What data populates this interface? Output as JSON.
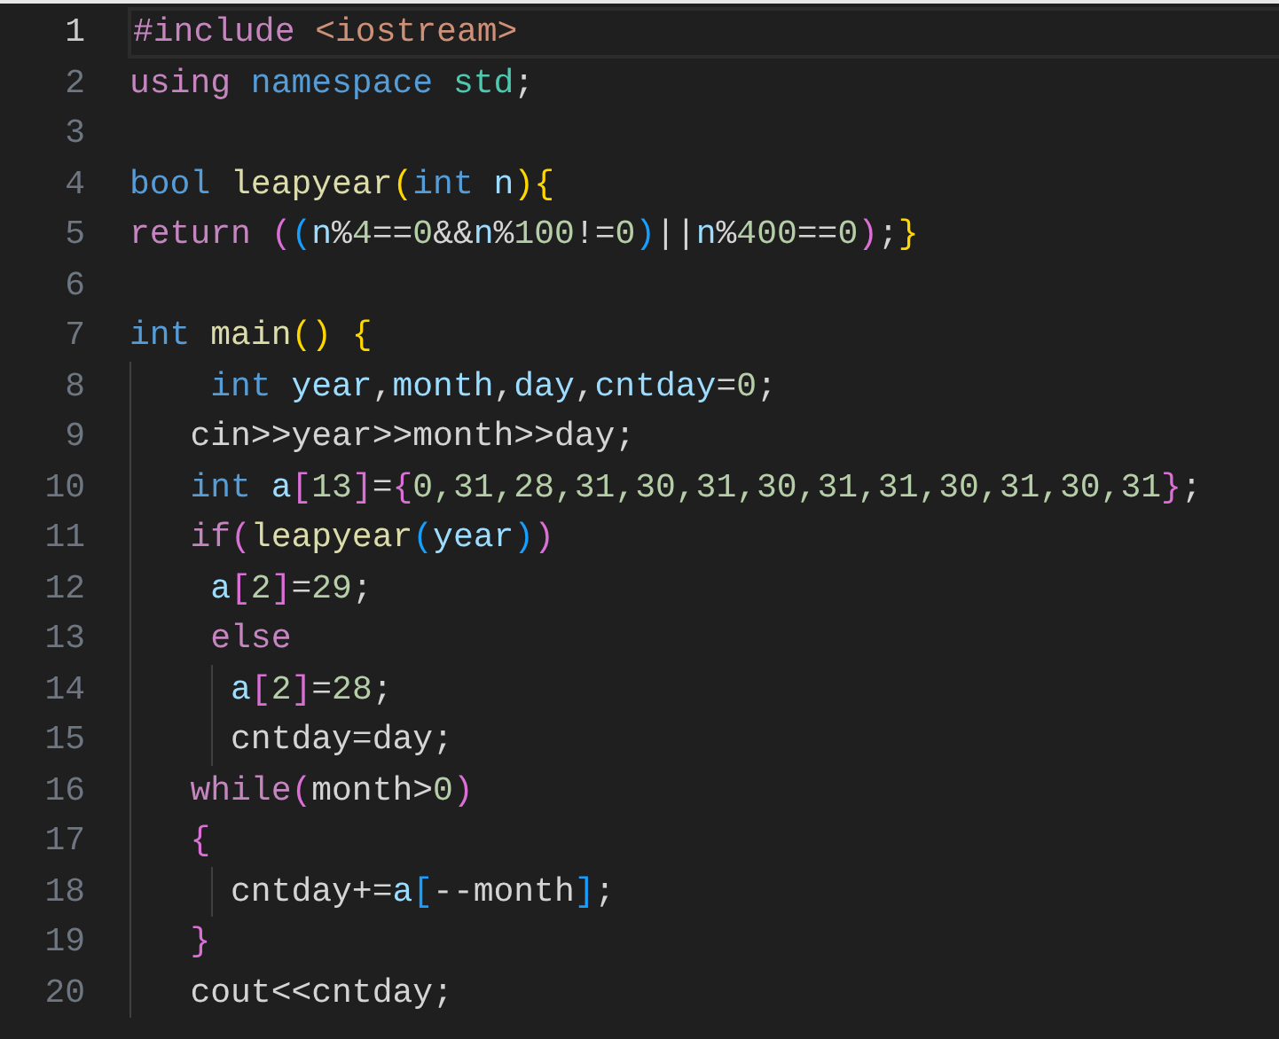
{
  "editor": {
    "lines": [
      {
        "number": "1",
        "current": true,
        "tokens": [
          {
            "kind": "keyword",
            "text": "#include "
          },
          {
            "kind": "string",
            "text": "<iostream>"
          }
        ]
      },
      {
        "number": "2",
        "current": false,
        "tokens": [
          {
            "kind": "keyword",
            "text": "using "
          },
          {
            "kind": "type",
            "text": "namespace "
          },
          {
            "kind": "namespace",
            "text": "std"
          },
          {
            "kind": "plain",
            "text": ";"
          }
        ]
      },
      {
        "number": "3",
        "current": false
      },
      {
        "number": "4",
        "current": false,
        "tokens": [
          {
            "kind": "type",
            "text": "bool "
          },
          {
            "kind": "function",
            "text": "leapyear"
          },
          {
            "kind": "bracket1",
            "text": "("
          },
          {
            "kind": "type",
            "text": "int "
          },
          {
            "kind": "variable",
            "text": "n"
          },
          {
            "kind": "bracket1",
            "text": ")"
          },
          {
            "kind": "bracket1",
            "text": "{"
          }
        ]
      },
      {
        "number": "5",
        "current": false,
        "tokens": [
          {
            "kind": "keyword",
            "text": "return "
          },
          {
            "kind": "bracket2",
            "text": "("
          },
          {
            "kind": "bracket3",
            "text": "("
          },
          {
            "kind": "variable",
            "text": "n"
          },
          {
            "kind": "plain",
            "text": "%"
          },
          {
            "kind": "number",
            "text": "4"
          },
          {
            "kind": "plain",
            "text": "=="
          },
          {
            "kind": "number",
            "text": "0"
          },
          {
            "kind": "plain",
            "text": "&&"
          },
          {
            "kind": "variable",
            "text": "n"
          },
          {
            "kind": "plain",
            "text": "%"
          },
          {
            "kind": "number",
            "text": "100"
          },
          {
            "kind": "plain",
            "text": "!="
          },
          {
            "kind": "number",
            "text": "0"
          },
          {
            "kind": "bracket3",
            "text": ")"
          },
          {
            "kind": "plain",
            "text": "||"
          },
          {
            "kind": "variable",
            "text": "n"
          },
          {
            "kind": "plain",
            "text": "%"
          },
          {
            "kind": "number",
            "text": "400"
          },
          {
            "kind": "plain",
            "text": "=="
          },
          {
            "kind": "number",
            "text": "0"
          },
          {
            "kind": "bracket2",
            "text": ")"
          },
          {
            "kind": "plain",
            "text": ";"
          },
          {
            "kind": "bracket1",
            "text": "}"
          }
        ]
      },
      {
        "number": "6",
        "current": false
      },
      {
        "number": "7",
        "current": false,
        "tokens": [
          {
            "kind": "type",
            "text": "int "
          },
          {
            "kind": "function",
            "text": "main"
          },
          {
            "kind": "bracket1",
            "text": "() {"
          }
        ]
      },
      {
        "number": "8",
        "current": false,
        "tokens": [
          {
            "kind": "type",
            "text": "    int "
          },
          {
            "kind": "variable",
            "text": "year"
          },
          {
            "kind": "plain",
            "text": ","
          },
          {
            "kind": "variable",
            "text": "month"
          },
          {
            "kind": "plain",
            "text": ","
          },
          {
            "kind": "variable",
            "text": "day"
          },
          {
            "kind": "plain",
            "text": ","
          },
          {
            "kind": "variable",
            "text": "cntday"
          },
          {
            "kind": "plain",
            "text": "="
          },
          {
            "kind": "number",
            "text": "0"
          },
          {
            "kind": "plain",
            "text": ";"
          }
        ]
      },
      {
        "number": "9",
        "current": false,
        "tokens": [
          {
            "kind": "plain",
            "text": "   cin>>year>>month>>day;"
          }
        ]
      },
      {
        "number": "10",
        "current": false,
        "tokens": [
          {
            "kind": "type",
            "text": "   int "
          },
          {
            "kind": "variable",
            "text": "a"
          },
          {
            "kind": "bracket2",
            "text": "["
          },
          {
            "kind": "number",
            "text": "13"
          },
          {
            "kind": "bracket2",
            "text": "]"
          },
          {
            "kind": "plain",
            "text": "="
          },
          {
            "kind": "bracket2",
            "text": "{"
          },
          {
            "kind": "number",
            "text": "0,31,28,31,30,31,30,31,31,30,31,30,31"
          },
          {
            "kind": "bracket2",
            "text": "}"
          },
          {
            "kind": "plain",
            "text": ";"
          }
        ]
      },
      {
        "number": "11",
        "current": false,
        "tokens": [
          {
            "kind": "keyword",
            "text": "   if"
          },
          {
            "kind": "bracket2",
            "text": "("
          },
          {
            "kind": "function",
            "text": "leapyear"
          },
          {
            "kind": "bracket3",
            "text": "("
          },
          {
            "kind": "variable",
            "text": "year"
          },
          {
            "kind": "bracket3",
            "text": ")"
          },
          {
            "kind": "bracket2",
            "text": ")"
          }
        ]
      },
      {
        "number": "12",
        "current": false,
        "tokens": [
          {
            "kind": "variable",
            "text": "    a"
          },
          {
            "kind": "bracket2",
            "text": "["
          },
          {
            "kind": "number",
            "text": "2"
          },
          {
            "kind": "bracket2",
            "text": "]"
          },
          {
            "kind": "plain",
            "text": "="
          },
          {
            "kind": "number",
            "text": "29"
          },
          {
            "kind": "plain",
            "text": ";"
          }
        ]
      },
      {
        "number": "13",
        "current": false,
        "tokens": [
          {
            "kind": "keyword",
            "text": "    else"
          }
        ]
      },
      {
        "number": "14",
        "current": false,
        "tokens": [
          {
            "kind": "variable",
            "text": "     a"
          },
          {
            "kind": "bracket2",
            "text": "["
          },
          {
            "kind": "number",
            "text": "2"
          },
          {
            "kind": "bracket2",
            "text": "]"
          },
          {
            "kind": "plain",
            "text": "="
          },
          {
            "kind": "number",
            "text": "28"
          },
          {
            "kind": "plain",
            "text": ";"
          }
        ]
      },
      {
        "number": "15",
        "current": false,
        "tokens": [
          {
            "kind": "plain",
            "text": "     cntday=day;"
          }
        ]
      },
      {
        "number": "16",
        "current": false,
        "tokens": [
          {
            "kind": "keyword",
            "text": "   while"
          },
          {
            "kind": "bracket2",
            "text": "("
          },
          {
            "kind": "plain",
            "text": "month>"
          },
          {
            "kind": "number",
            "text": "0"
          },
          {
            "kind": "bracket2",
            "text": ")"
          }
        ]
      },
      {
        "number": "17",
        "current": false,
        "tokens": [
          {
            "kind": "bracket2",
            "text": "   {"
          }
        ]
      },
      {
        "number": "18",
        "current": false,
        "tokens": [
          {
            "kind": "plain",
            "text": "     cntday+="
          },
          {
            "kind": "variable",
            "text": "a"
          },
          {
            "kind": "bracket3",
            "text": "["
          },
          {
            "kind": "plain",
            "text": "--month"
          },
          {
            "kind": "bracket3",
            "text": "]"
          },
          {
            "kind": "plain",
            "text": ";"
          }
        ]
      },
      {
        "number": "19",
        "current": false,
        "tokens": [
          {
            "kind": "bracket2",
            "text": "   }"
          }
        ]
      },
      {
        "number": "20",
        "current": false,
        "tokens": [
          {
            "kind": "plain",
            "text": "   cout<<cntday;"
          }
        ]
      }
    ]
  }
}
